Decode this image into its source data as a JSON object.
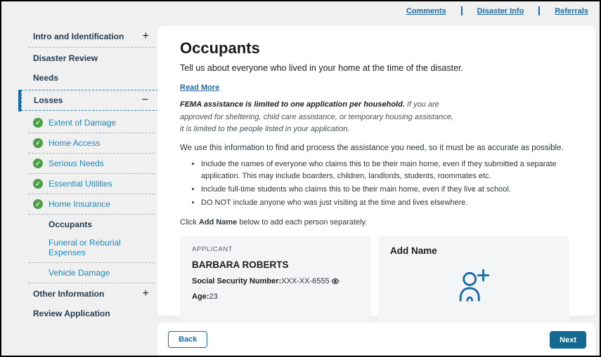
{
  "top_nav": {
    "links": [
      {
        "label": "Comments"
      },
      {
        "label": "Disaster Info"
      },
      {
        "label": "Referrals"
      }
    ]
  },
  "sidebar": {
    "items": [
      {
        "label": "Intro and Identification"
      },
      {
        "label": "Disaster Review"
      },
      {
        "label": "Needs"
      },
      {
        "label": "Losses"
      },
      {
        "label": "Extent of Damage"
      },
      {
        "label": "Home Access"
      },
      {
        "label": "Serious Needs"
      },
      {
        "label": "Essential Utilities"
      },
      {
        "label": "Home Insurance"
      },
      {
        "label": "Occupants"
      },
      {
        "label": "Funeral or Reburial Expenses"
      },
      {
        "label": "Vehicle Damage"
      },
      {
        "label": "Other Information"
      },
      {
        "label": "Review Application"
      }
    ]
  },
  "icons": {
    "expand": "+",
    "collapse": "−",
    "check": "✓"
  },
  "main": {
    "title": "Occupants",
    "subtitle": "Tell us about everyone who lived in your home at the time of the disaster.",
    "read_more": "Read More",
    "notice": {
      "bold": "FEMA assistance is limited to one application per household.",
      "line1_rest": " If you are",
      "line2": "approved for sheltering, child care assistance, or temporary housing assistance,",
      "line3": "it is limited to the people listed in your application."
    },
    "intro": "We use this information to find and process the assistance you need, so it must be as accurate as possible.",
    "bullets": [
      "Include the names of everyone who claims this to be their main home, even if they submitted a separate application. This may include boarders, children, landlords, students, roommates etc.",
      "Include full-time students who claims this to be their main home, even if they live at school.",
      "DO NOT include anyone who was just visiting at the time and lives elsewhere."
    ],
    "click_instruction": {
      "pre": "Click ",
      "bold": "Add Name",
      "post": " below to add each person separately."
    },
    "applicant_card": {
      "tag": "APPLICANT",
      "name": "BARBARA ROBERTS",
      "ssn_label": "Social Security Number:",
      "ssn_value": " XXX-XX-6555",
      "age_label": "Age:",
      "age_value": " 23"
    },
    "add_card": {
      "title": "Add Name"
    }
  },
  "footer": {
    "back": "Back",
    "next": "Next"
  },
  "colors": {
    "accent_blue": "#1b6ca8",
    "sidebar_link_blue": "#2186ba",
    "button_blue": "#15688f",
    "success_green": "#4ba046",
    "page_bg": "#f0f0f1",
    "card_bg": "#f4f5f7"
  }
}
